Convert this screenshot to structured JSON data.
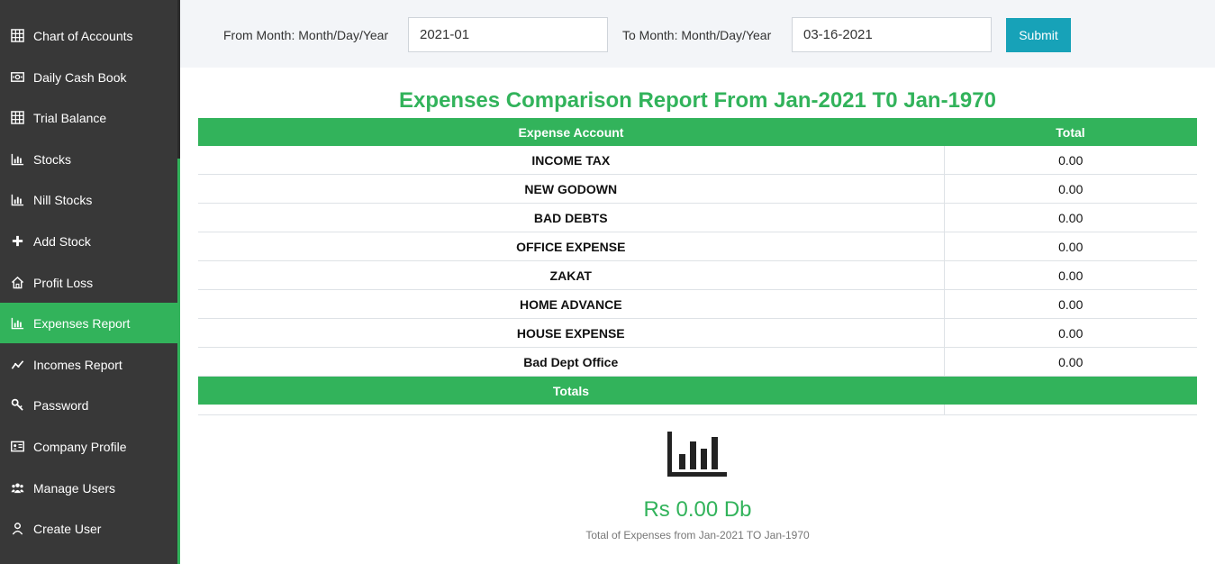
{
  "sidebar": {
    "items": [
      {
        "label": "Chart of Accounts",
        "icon": "grid-icon",
        "active": false
      },
      {
        "label": "Daily Cash Book",
        "icon": "money-bill-icon",
        "active": false
      },
      {
        "label": "Trial Balance",
        "icon": "grid-icon",
        "active": false
      },
      {
        "label": "Stocks",
        "icon": "bar-chart-icon",
        "active": false
      },
      {
        "label": "Nill Stocks",
        "icon": "bar-chart-icon",
        "active": false
      },
      {
        "label": "Add Stock",
        "icon": "plus-icon",
        "active": false
      },
      {
        "label": "Profit Loss",
        "icon": "home-icon",
        "active": false
      },
      {
        "label": "Expenses Report",
        "icon": "bar-chart-icon",
        "active": true
      },
      {
        "label": "Incomes Report",
        "icon": "line-chart-icon",
        "active": false
      },
      {
        "label": "Password",
        "icon": "key-icon",
        "active": false
      },
      {
        "label": "Company Profile",
        "icon": "id-card-icon",
        "active": false
      },
      {
        "label": "Manage Users",
        "icon": "users-icon",
        "active": false
      },
      {
        "label": "Create User",
        "icon": "user-icon",
        "active": false
      }
    ]
  },
  "filter": {
    "from_label": "From Month: Month/Day/Year",
    "from_value": "2021-01",
    "to_label": "To Month: Month/Day/Year",
    "to_value": "03-16-2021",
    "submit_label": "Submit"
  },
  "report": {
    "title": "Expenses Comparison Report From Jan-2021 T0 Jan-1970",
    "columns": [
      "Expense Account",
      "Total"
    ],
    "rows": [
      {
        "account": "INCOME TAX",
        "total": "0.00"
      },
      {
        "account": "NEW GODOWN",
        "total": "0.00"
      },
      {
        "account": "BAD DEBTS",
        "total": "0.00"
      },
      {
        "account": "OFFICE EXPENSE",
        "total": "0.00"
      },
      {
        "account": "ZAKAT",
        "total": "0.00"
      },
      {
        "account": "HOME ADVANCE",
        "total": "0.00"
      },
      {
        "account": "HOUSE EXPENSE",
        "total": "0.00"
      },
      {
        "account": "Bad Dept Office",
        "total": "0.00"
      }
    ],
    "totals_label": "Totals",
    "totals_value": ""
  },
  "summary": {
    "icon": "bar-chart-icon",
    "value": "Rs 0.00 Db",
    "caption": "Total of Expenses from Jan-2021 TO Jan-1970"
  },
  "colors": {
    "accent": "#32b35b",
    "sidebar": "#383838",
    "submit": "#17a2b8"
  }
}
